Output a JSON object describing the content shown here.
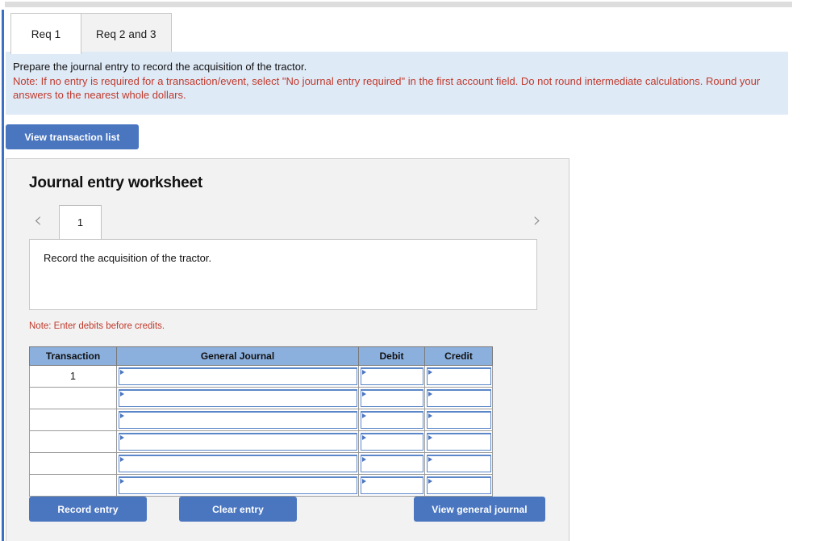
{
  "tabs": [
    {
      "label": "Req 1",
      "active": true
    },
    {
      "label": "Req 2 and 3",
      "active": false
    }
  ],
  "instructions": {
    "primary": "Prepare the journal entry to record the acquisition of the tractor.",
    "note": "Note: If no entry is required for a transaction/event, select \"No journal entry required\" in the first account field. Do not round intermediate calculations. Round your answers to the nearest whole dollars."
  },
  "toolbar": {
    "view_transaction_list_label": "View transaction list"
  },
  "worksheet": {
    "title": "Journal entry worksheet",
    "pager": {
      "prev_icon": "‹",
      "next_icon": "›",
      "pages": [
        {
          "label": "1",
          "active": true
        }
      ]
    },
    "description": "Record the acquisition of the tractor.",
    "debits_note": "Note: Enter debits before credits.",
    "table": {
      "columns": [
        "Transaction",
        "General Journal",
        "Debit",
        "Credit"
      ],
      "rows": [
        {
          "transaction": "1",
          "general_journal": "",
          "debit": "",
          "credit": ""
        },
        {
          "transaction": "",
          "general_journal": "",
          "debit": "",
          "credit": ""
        },
        {
          "transaction": "",
          "general_journal": "",
          "debit": "",
          "credit": ""
        },
        {
          "transaction": "",
          "general_journal": "",
          "debit": "",
          "credit": ""
        },
        {
          "transaction": "",
          "general_journal": "",
          "debit": "",
          "credit": ""
        },
        {
          "transaction": "",
          "general_journal": "",
          "debit": "",
          "credit": ""
        }
      ]
    },
    "buttons": {
      "record_entry": "Record entry",
      "clear_entry": "Clear entry",
      "view_general_journal": "View general journal"
    }
  },
  "colors": {
    "accent_blue": "#4a76c0",
    "table_header_blue": "#8cb0de",
    "instruction_panel_blue": "#dfeaf7",
    "note_red": "#c0392b",
    "panel_gray": "#f2f2f2"
  }
}
